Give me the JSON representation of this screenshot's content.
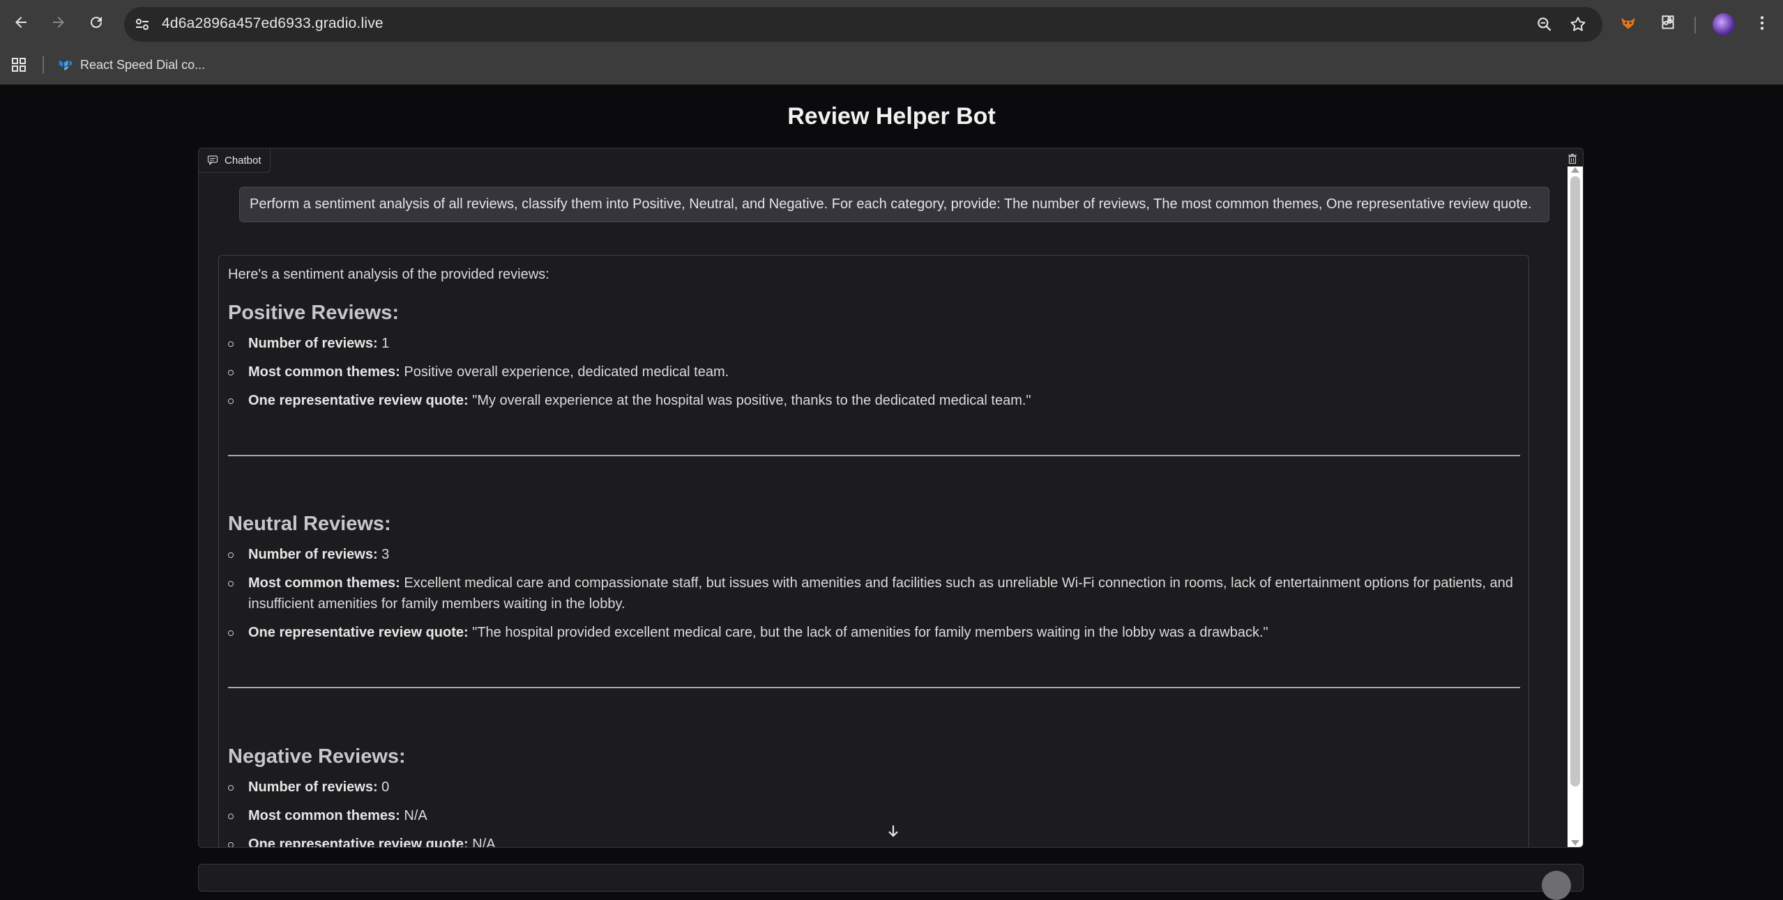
{
  "browser": {
    "url": "4d6a2896a457ed6933.gradio.live",
    "bookmarks": [
      {
        "label": "React Speed Dial co..."
      }
    ]
  },
  "page": {
    "title": "Review Helper Bot"
  },
  "chatbot": {
    "label": "Chatbot",
    "user_message": "Perform a sentiment analysis of all reviews, classify them into Positive, Neutral, and Negative. For each category, provide: The number of reviews, The most common themes, One representative review quote.",
    "bot_intro": "Here's a sentiment analysis of the provided reviews:",
    "sections": [
      {
        "heading": "Positive Reviews:",
        "items": [
          {
            "label": "Number of reviews:",
            "value": "1"
          },
          {
            "label": "Most common themes:",
            "value": "Positive overall experience, dedicated medical team."
          },
          {
            "label": "One representative review quote:",
            "value": "\"My overall experience at the hospital was positive, thanks to the dedicated medical team.\""
          }
        ]
      },
      {
        "heading": "Neutral Reviews:",
        "items": [
          {
            "label": "Number of reviews:",
            "value": "3"
          },
          {
            "label": "Most common themes:",
            "value": "Excellent medical care and compassionate staff, but issues with amenities and facilities such as unreliable Wi-Fi connection in rooms, lack of entertainment options for patients, and insufficient amenities for family members waiting in the lobby."
          },
          {
            "label": "One representative review quote:",
            "value": "\"The hospital provided excellent medical care, but the lack of amenities for family members waiting in the lobby was a drawback.\""
          }
        ]
      },
      {
        "heading": "Negative Reviews:",
        "items": [
          {
            "label": "Number of reviews:",
            "value": "0"
          },
          {
            "label": "Most common themes:",
            "value": "N/A"
          },
          {
            "label": "One representative review quote:",
            "value": "N/A"
          }
        ]
      }
    ]
  }
}
